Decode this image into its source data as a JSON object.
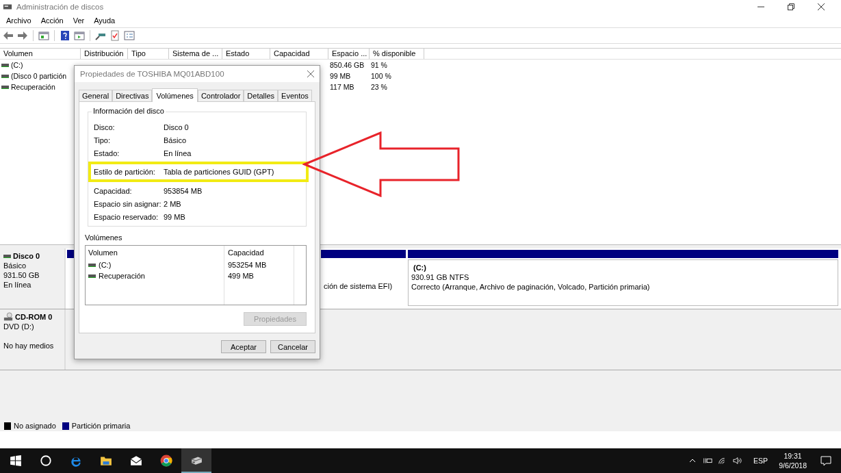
{
  "window": {
    "title": "Administración de discos"
  },
  "menu": [
    "Archivo",
    "Acción",
    "Ver",
    "Ayuda"
  ],
  "volume_table": {
    "columns": [
      "Volumen",
      "Distribución",
      "Tipo",
      "Sistema de ...",
      "Estado",
      "Capacidad",
      "Espacio ...",
      "% disponible"
    ],
    "rows": [
      {
        "volume": "(C:)",
        "free": "850.46 GB",
        "percent": "91 %"
      },
      {
        "volume": "(Disco 0 partición",
        "free": "99 MB",
        "percent": "100 %"
      },
      {
        "volume": "Recuperación",
        "free": "117 MB",
        "percent": "23 %"
      }
    ]
  },
  "disks": [
    {
      "kind": "disk",
      "name": "Disco 0",
      "lines": [
        "Básico",
        "931.50 GB",
        "En línea"
      ],
      "partitions": [
        {
          "color": "#000080"
        },
        {
          "color": "#000080",
          "lines": [
            "ción de sistema EFI)"
          ]
        },
        {
          "color": "#000080",
          "name": "(C:)",
          "lines": [
            "930.91 GB NTFS",
            "Correcto (Arranque, Archivo de paginación, Volcado, Partición primaria)"
          ]
        }
      ]
    },
    {
      "kind": "cdrom",
      "name": "CD-ROM 0",
      "lines": [
        "DVD (D:)",
        "No hay medios"
      ]
    }
  ],
  "legend": [
    {
      "label": "No asignado",
      "color": "#000000"
    },
    {
      "label": "Partición primaria",
      "color": "#000080"
    }
  ],
  "dialog": {
    "title": "Propiedades de TOSHIBA MQ01ABD100",
    "tabs": [
      {
        "label": "General",
        "selected": false
      },
      {
        "label": "Directivas",
        "selected": false
      },
      {
        "label": "Volúmenes",
        "selected": true
      },
      {
        "label": "Controlador",
        "selected": false
      },
      {
        "label": "Detalles",
        "selected": false
      },
      {
        "label": "Eventos",
        "selected": false
      }
    ],
    "group_title": "Información del disco",
    "fields": [
      {
        "label": "Disco:",
        "value": "Disco 0",
        "highlighted": false
      },
      {
        "label": "Tipo:",
        "value": "Básico",
        "highlighted": false
      },
      {
        "label": "Estado:",
        "value": "En línea",
        "highlighted": false
      },
      {
        "label": "Estilo de partición:",
        "value": "Tabla de particiones GUID (GPT)",
        "highlighted": true
      },
      {
        "label": "Capacidad:",
        "value": "953854 MB",
        "highlighted": false
      },
      {
        "label": "Espacio sin asignar:",
        "value": "2 MB",
        "highlighted": false
      },
      {
        "label": "Espacio reservado:",
        "value": "99 MB",
        "highlighted": false
      }
    ],
    "volumes_label": "Volúmenes",
    "volume_columns": [
      "Volumen",
      "Capacidad"
    ],
    "volumes": [
      {
        "name": "(C:)",
        "capacity": "953254 MB"
      },
      {
        "name": "Recuperación",
        "capacity": "499 MB"
      }
    ],
    "properties_button": {
      "label": "Propiedades",
      "disabled": true
    },
    "buttons": [
      "Aceptar",
      "Cancelar"
    ]
  },
  "taskbar": {
    "apps": [
      {
        "kind": "search",
        "active": false
      },
      {
        "kind": "edge",
        "active": false
      },
      {
        "kind": "folder",
        "active": false
      },
      {
        "kind": "mail",
        "active": false
      },
      {
        "kind": "chrome",
        "active": false
      },
      {
        "kind": "disk",
        "active": true
      }
    ],
    "language": "ESP",
    "time": "19:31",
    "date": "9/6/2018"
  }
}
